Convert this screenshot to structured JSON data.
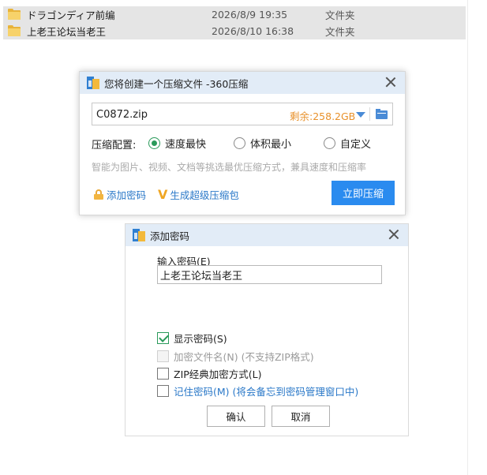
{
  "files": [
    {
      "name": "ドラゴンディア前编",
      "date": "2026/8/9 19:35",
      "type": "文件夹"
    },
    {
      "name": "上老王论坛当老王",
      "date": "2026/8/10 16:38",
      "type": "文件夹"
    }
  ],
  "compress_dialog": {
    "title": "您将创建一个压缩文件 -360压缩",
    "filename": "C0872.zip",
    "free_space": "剩余:258.2GB",
    "config_label": "压缩配置:",
    "options": [
      {
        "label": "速度最快",
        "checked": true
      },
      {
        "label": "体积最小",
        "checked": false
      },
      {
        "label": "自定义",
        "checked": false
      }
    ],
    "hint": "智能为图片、视频、文档等挑选最优压缩方式，兼具速度和压缩率",
    "add_password": "添加密码",
    "super_package": "生成超级压缩包",
    "compress_button": "立即压缩"
  },
  "password_dialog": {
    "title": "添加密码",
    "input_label": "输入密码(E)",
    "password_value": "上老王论坛当老王",
    "checkboxes": [
      {
        "label": "显示密码(S)",
        "checked": true,
        "disabled": false
      },
      {
        "label": "加密文件名(N) (不支持ZIP格式)",
        "checked": false,
        "disabled": true
      },
      {
        "label": "ZIP经典加密方式(L)",
        "checked": false,
        "disabled": false
      },
      {
        "label": "记住密码(M) (将会备忘到密码管理窗口中)",
        "checked": false,
        "disabled": false
      }
    ],
    "ok_button": "确认",
    "cancel_button": "取消"
  },
  "colors": {
    "accent_blue": "#2a8bef",
    "link_blue": "#2a78c8",
    "free_space_orange": "#e8912b",
    "radio_green": "#2a9a5a",
    "title_bar": "#e2ecf7",
    "row_selected": "#e5e5e5"
  }
}
